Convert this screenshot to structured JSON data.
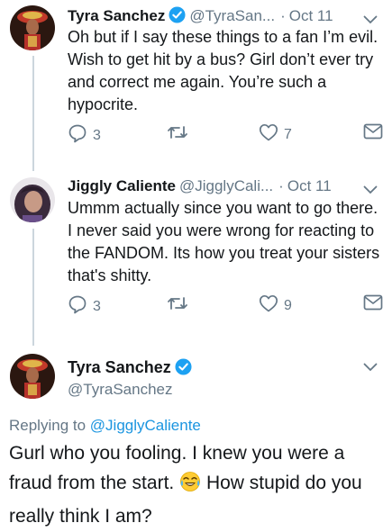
{
  "tweets": [
    {
      "name": "Tyra Sanchez",
      "handle": "@TyraSan...",
      "date": "Oct 11",
      "text": "Oh but if I say these things to a fan I’m evil. Wish to get hit by a bus? Girl don’t ever try and correct me again. You’re such a hypocrite.",
      "replies": "3",
      "retweets": "",
      "likes": "7"
    },
    {
      "name": "Jiggly Caliente",
      "handle": "@JigglyCali...",
      "date": "Oct 11",
      "text": "Ummm actually since you want to go there. I never said you were wrong for reacting to the FANDOM. Its how you treat your sisters that's shitty.",
      "replies": "3",
      "retweets": "",
      "likes": "9"
    }
  ],
  "focus": {
    "name": "Tyra Sanchez",
    "handle": "@TyraSanchez",
    "replying_prefix": "Replying to",
    "replying_to": "@JigglyCaliente",
    "text_part1": "Gurl who you fooling. I knew you were a fraud from the start.",
    "text_part2": "How stupid do you really think I am?",
    "emoji": "face-with-tears-of-joy"
  },
  "colors": {
    "verified": "#1da1f2",
    "muted": "#657786",
    "link": "#1b95e0",
    "thread_line": "#ccd6dd"
  }
}
